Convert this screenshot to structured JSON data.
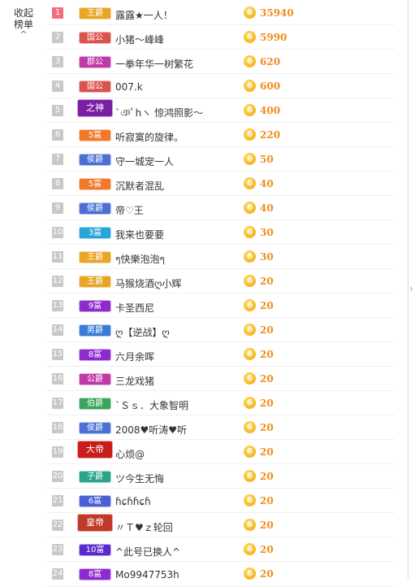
{
  "sidebar": {
    "collapse_label_line1": "收起",
    "collapse_label_line2": "榜单",
    "collapse_arrow": "^"
  },
  "coin_glyph": "6",
  "rows": [
    {
      "rank": "1",
      "badge": "王爵",
      "badge_color": "#e8a526",
      "name": "露露★一人！",
      "score": "35940"
    },
    {
      "rank": "2",
      "badge": "国公",
      "badge_color": "#d9534f",
      "name": "小猪～峰峰",
      "score": "5990"
    },
    {
      "rank": "3",
      "badge": "郡公",
      "badge_color": "#c03aa7",
      "name": "一拳年华一树繁花",
      "score": "620"
    },
    {
      "rank": "4",
      "badge": "国公",
      "badge_color": "#d9534f",
      "name": "007.k",
      "score": "600"
    },
    {
      "rank": "5",
      "badge": "之神",
      "badge_color": "#7a1fa2",
      "name": "`ঞﾟhヽ 惊鸿照影～",
      "score": "400"
    },
    {
      "rank": "6",
      "badge": "5富",
      "badge_color": "#f07a2a",
      "name": "听寂寞的旋律。",
      "score": "220"
    },
    {
      "rank": "7",
      "badge": "侯爵",
      "badge_color": "#4c6fd6",
      "name": "守一城宠一人",
      "score": "50"
    },
    {
      "rank": "8",
      "badge": "5富",
      "badge_color": "#f07a2a",
      "name": "沉默者混乱",
      "score": "40"
    },
    {
      "rank": "9",
      "badge": "侯爵",
      "badge_color": "#4c6fd6",
      "name": "帝♡王",
      "score": "40"
    },
    {
      "rank": "10",
      "badge": "3富",
      "badge_color": "#27a5d9",
      "name": "我来也要要",
      "score": "30"
    },
    {
      "rank": "11",
      "badge": "王爵",
      "badge_color": "#e8a526",
      "name": "ๆ快樂泡泡ๆ",
      "score": "30"
    },
    {
      "rank": "12",
      "badge": "王爵",
      "badge_color": "#e8a526",
      "name": "马猴烧酒ღ小辉",
      "score": "20"
    },
    {
      "rank": "13",
      "badge": "9富",
      "badge_color": "#8e2bcf",
      "name": "卡圣西尼",
      "score": "20"
    },
    {
      "rank": "14",
      "badge": "男爵",
      "badge_color": "#3a7bd5",
      "name": "ღ【逆战】ღ",
      "score": "20"
    },
    {
      "rank": "15",
      "badge": "8富",
      "badge_color": "#8e2bcf",
      "name": "六月余晖",
      "score": "20"
    },
    {
      "rank": "16",
      "badge": "公爵",
      "badge_color": "#c03aa7",
      "name": "三龙戏猪",
      "score": "20"
    },
    {
      "rank": "17",
      "badge": "伯爵",
      "badge_color": "#3aa55c",
      "name": "`Ｓｓ．大象智明",
      "score": "20"
    },
    {
      "rank": "18",
      "badge": "侯爵",
      "badge_color": "#4c6fd6",
      "name": "2008♥听涛♥听",
      "score": "20"
    },
    {
      "rank": "19",
      "badge": "大帝",
      "badge_color": "#c81d1d",
      "name": "心烦@",
      "score": "20"
    },
    {
      "rank": "20",
      "badge": "子爵",
      "badge_color": "#2aa58a",
      "name": "ツ今生无悔",
      "score": "20"
    },
    {
      "rank": "21",
      "badge": "6富",
      "badge_color": "#4b5fd6",
      "name": "ɦɕɦɦɕɦ",
      "score": "20"
    },
    {
      "rank": "22",
      "badge": "皇帝",
      "badge_color": "#c0392b",
      "name": "〃Ｔ♥ｚ轮回",
      "score": "20"
    },
    {
      "rank": "23",
      "badge": "10富",
      "badge_color": "#5a2bcf",
      "name": "^此号已换人^",
      "score": "20"
    },
    {
      "rank": "24",
      "badge": "8富",
      "badge_color": "#8e2bcf",
      "name": "Mo9947753h",
      "score": "20"
    }
  ]
}
